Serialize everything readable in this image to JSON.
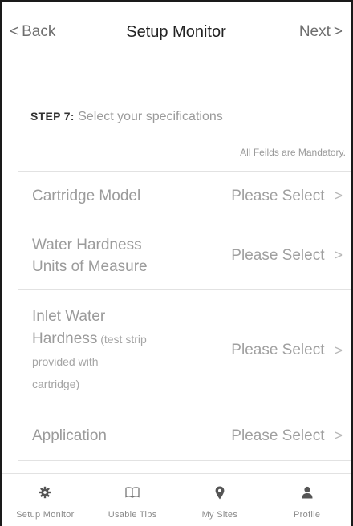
{
  "header": {
    "back_label": "Back",
    "title": "Setup Monitor",
    "next_label": "Next"
  },
  "step": {
    "number": "STEP 7:",
    "text": "Select your specifications",
    "mandatory_note": "All Feilds are Mandatory."
  },
  "form": {
    "rows": [
      {
        "label": "Cartridge Model",
        "value": "Please Select"
      },
      {
        "label_line1": "Water Hardness",
        "label_line2": "Units of Measure",
        "value": "Please Select"
      },
      {
        "label_line1": "Inlet Water",
        "label_line2": "Hardness",
        "hint_a": " (test strip",
        "hint_b": "provided with",
        "hint_c": "cartridge)",
        "value": "Please Select"
      },
      {
        "label": "Application",
        "value": "Please Select"
      }
    ]
  },
  "tabbar": {
    "items": [
      {
        "label": "Setup Monitor",
        "icon": "gear-icon"
      },
      {
        "label": "Usable Tips",
        "icon": "book-icon"
      },
      {
        "label": "My Sites",
        "icon": "map-pin-icon"
      },
      {
        "label": "Profile",
        "icon": "person-icon"
      }
    ]
  },
  "colors": {
    "text_muted": "#9b9b9b",
    "title": "#222222",
    "divider": "#e2e2e2"
  }
}
